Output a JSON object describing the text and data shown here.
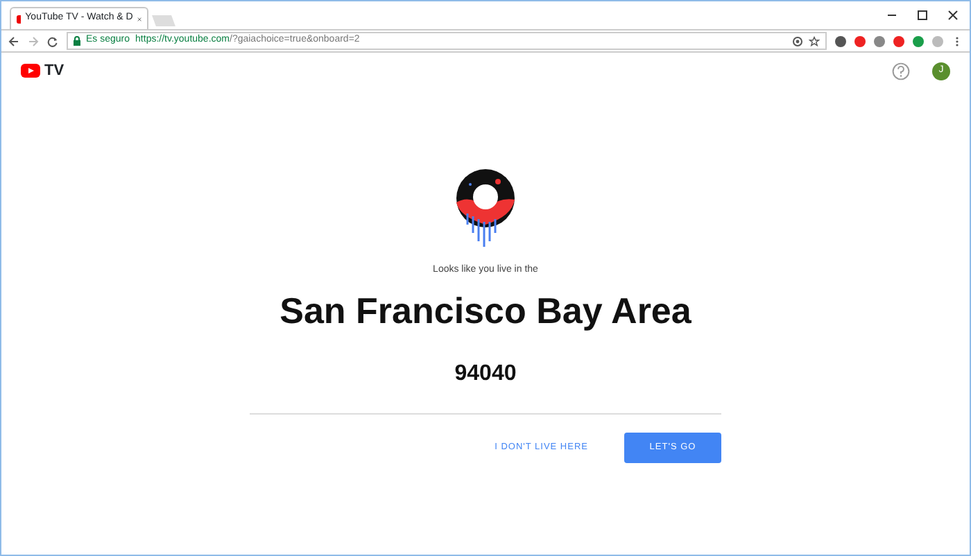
{
  "browser": {
    "tab_title": "YouTube TV - Watch & D",
    "security_label": "Es seguro",
    "url_host": "https://tv.youtube.com",
    "url_rest": "/?gaiachoice=true&onboard=2"
  },
  "header": {
    "logo_text": "TV",
    "avatar_letter": "J"
  },
  "location": {
    "prompt": "Looks like you live in the",
    "area": "San Francisco Bay Area",
    "zip": "94040"
  },
  "buttons": [
    {
      "label": "I DON'T LIVE HERE",
      "kind": "link"
    },
    {
      "label": "LET'S GO",
      "kind": "primary"
    }
  ]
}
